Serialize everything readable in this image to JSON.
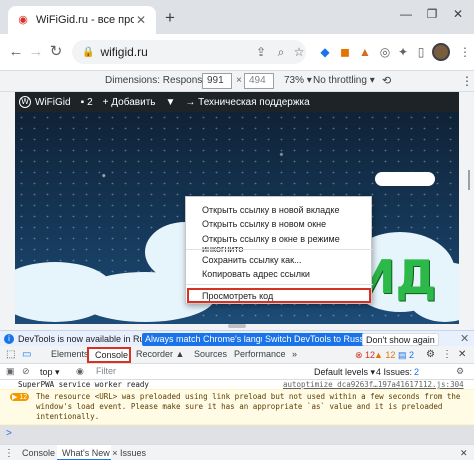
{
  "browser": {
    "tab_title": "WiFiGid.ru - все про WiFi и бесп",
    "url": "wifigid.ru",
    "colors": {
      "accent": "#1a73e8",
      "highlight_red": "#d93025"
    }
  },
  "device_toolbar": {
    "dimensions_label": "Dimensions: Responsive ▾",
    "width": "991",
    "height": "494",
    "zoom": "73% ▾",
    "throttling": "No throttling ▾"
  },
  "wp_admin_bar": {
    "site": "WiFiGid",
    "comments": "2",
    "add_new": "+ Добавить",
    "support": "→ Техническая поддержка"
  },
  "brand_text": "ИД",
  "context_menu": {
    "items": [
      "Открыть ссылку в новой вкладке",
      "Открыть ссылку в новом окне",
      "Открыть ссылку в окне в режиме инкогнито",
      "Сохранить ссылку как...",
      "Копировать адрес ссылки",
      "Просмотреть код"
    ]
  },
  "infobar": {
    "message": "DevTools is now available in Russian!",
    "btn_match": "Always match Chrome's language",
    "btn_switch": "Switch DevTools to Russian",
    "btn_dismiss": "Don't show again"
  },
  "devtools_tabs": {
    "elements": "Elements",
    "console": "Console",
    "recorder": "Recorder ▲",
    "sources": "Sources",
    "performance": "Performance",
    "more": "»",
    "errors": "12",
    "warnings": "12",
    "info": "2"
  },
  "console_toolbar": {
    "context": "top ▾",
    "filter_placeholder": "Filter",
    "levels": "Default levels ▾",
    "issues": "4 Issues:",
    "issues_count": "2"
  },
  "console": {
    "msg1": "SuperPWA service worker ready",
    "msg1_source": "autoptimize_dca9263f…197a41617112.js:304",
    "warn_count": "12",
    "warn_lines": [
      "The resource <URL> was preloaded using link preload but not used within a few seconds from the",
      "window's load event. Please make sure it has an appropriate `as` value and it is preloaded",
      "intentionally."
    ],
    "prompt": ">"
  },
  "drawer": {
    "tabs": [
      "Console",
      "What's New ×",
      "Issues"
    ]
  }
}
